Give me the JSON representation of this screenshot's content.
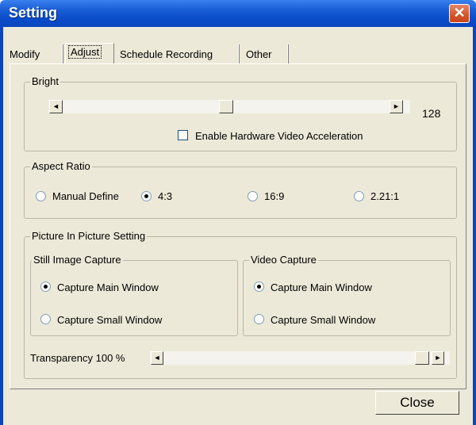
{
  "window": {
    "title": "Setting",
    "close_glyph": "✕"
  },
  "tabs": [
    {
      "label": "Modify",
      "selected": false
    },
    {
      "label": "Adjust",
      "selected": true
    },
    {
      "label": "Schedule Recording",
      "selected": false
    },
    {
      "label": "Other",
      "selected": false
    }
  ],
  "bright": {
    "legend": "Bright",
    "value": "128",
    "left_arrow": "◄",
    "right_arrow": "►",
    "hw_accel_label": "Enable Hardware Video Acceleration",
    "hw_accel_checked": false
  },
  "aspect": {
    "legend": "Aspect Ratio",
    "options": [
      "Manual Define",
      "4:3",
      "16:9",
      "2.21:1"
    ],
    "selected": "4:3"
  },
  "pip": {
    "legend": "Picture In Picture Setting",
    "still": {
      "legend": "Still Image Capture",
      "main": "Capture Main Window",
      "small": "Capture Small Window",
      "selected": "main"
    },
    "video": {
      "legend": "Video Capture",
      "main": "Capture Main Window",
      "small": "Capture Small Window",
      "selected": "main"
    },
    "transparency_label": "Transparency 100 %",
    "transparency_value": 100
  },
  "buttons": {
    "close": "Close"
  },
  "colors": {
    "title_bar": "#0a46c0",
    "face": "#ece9d8",
    "close_button": "#d35528"
  }
}
